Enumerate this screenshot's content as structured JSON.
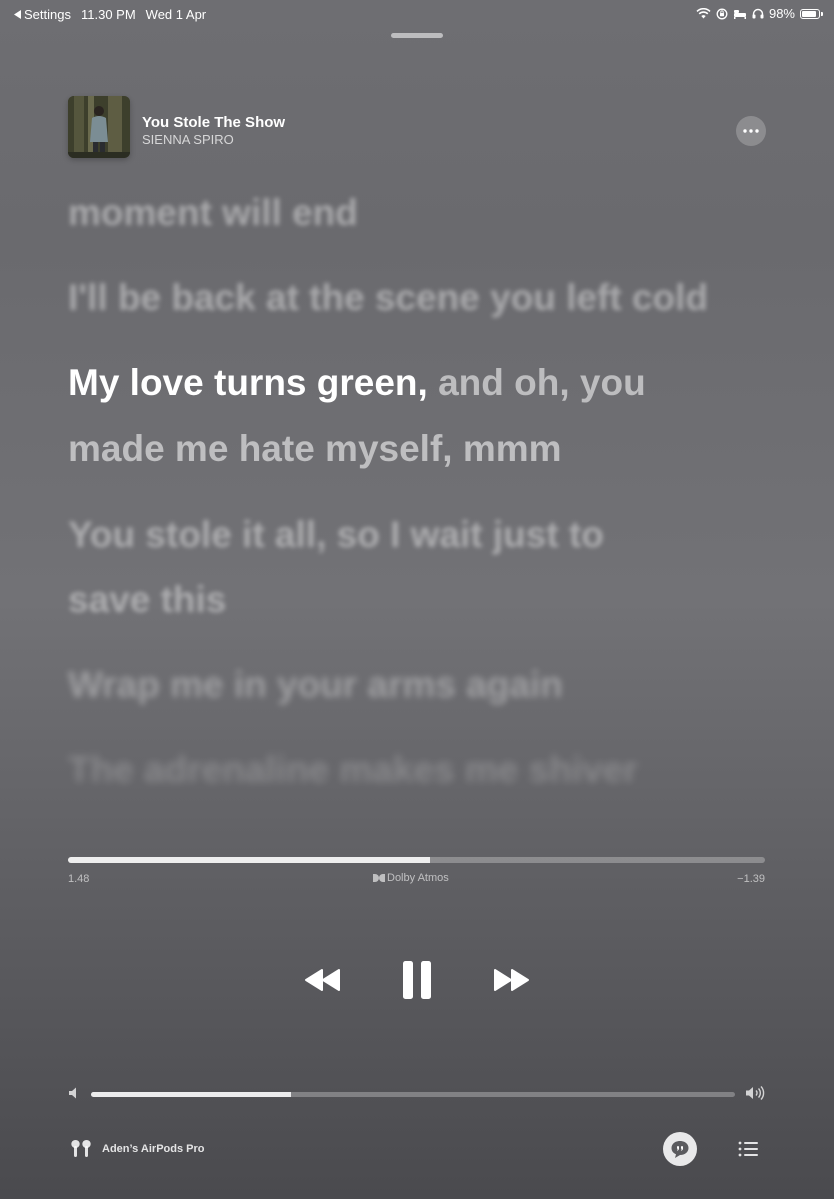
{
  "status_bar": {
    "back_label": "Settings",
    "time": "11.30 PM",
    "date": "Wed 1 Apr",
    "battery": "98%",
    "battery_level": 0.98,
    "icons": [
      "wifi-icon",
      "orientation-lock-icon",
      "sleep-icon",
      "headphones-icon",
      "battery-icon"
    ]
  },
  "now_playing": {
    "title": "You Stole The Show",
    "artist": "SIENNA SPIRO",
    "more_icon": "ellipsis-icon"
  },
  "lyrics": {
    "lines": [
      "moment will end",
      "I'll be back at the scene you left cold",
      "made me hate myself, mmm",
      "You stole it all, so I wait just to",
      "save this",
      "Wrap me in your arms again",
      "The adrenaline makes me shiver"
    ],
    "active_sung": "My love turns green,",
    "active_rest": " and oh, you"
  },
  "playback": {
    "elapsed": "1.48",
    "remaining": "−1.39",
    "progress": 0.52,
    "format_label": "Dolby Atmos"
  },
  "controls": {
    "icons": [
      "backward-icon",
      "pause-icon",
      "forward-icon"
    ]
  },
  "volume": {
    "level": 0.31
  },
  "output": {
    "device_name": "Aden’s AirPods Pro"
  },
  "colors": {
    "background": "#6c6c70",
    "foreground": "#ffffff"
  }
}
